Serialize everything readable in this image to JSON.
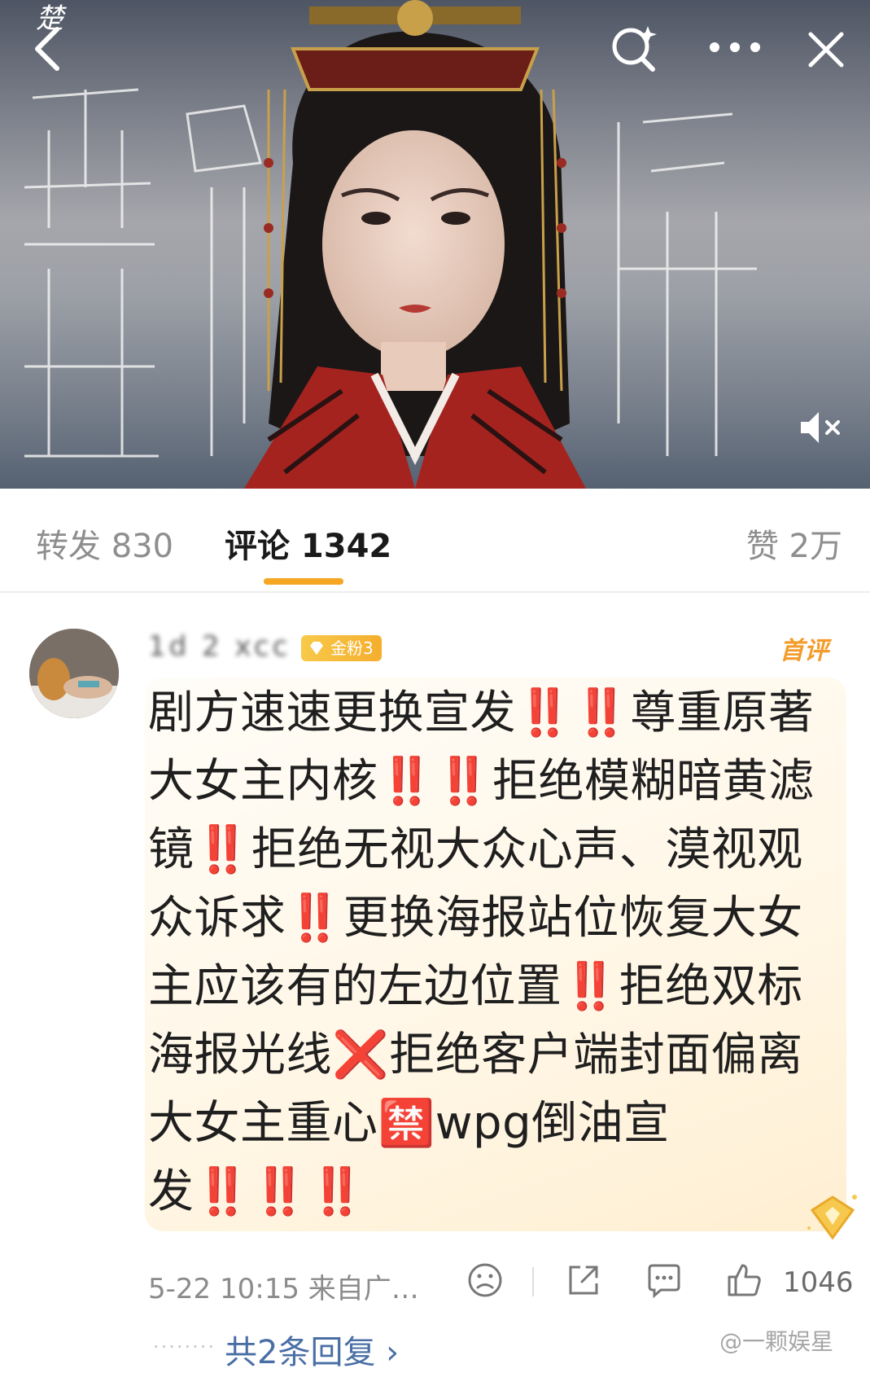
{
  "hero": {
    "title_calligraphy": "楚",
    "overlay_characters": [
      "垂",
      "帘",
      "听"
    ],
    "colors": {
      "sky_top": "#5f6775",
      "sky_mid": "#a5a6ac",
      "robe_red": "#a5231f"
    }
  },
  "tabs": {
    "repost": "转发 830",
    "comment": "评论 1342",
    "like": "赞 2万"
  },
  "comment": {
    "username": "1d  2  xcc",
    "fan_badge": "金粉3",
    "tag": "首评",
    "text": "剧方速速更换宣发‼️‼️尊重原著大女主内核‼️‼️拒绝模糊暗黄滤镜‼️拒绝无视大众心声、漠视观众诉求‼️更换海报站位恢复大女主应该有的左边位置‼️拒绝双标海报光线❌拒绝客户端封面偏离大女主重心🈲wpg倒油宣发‼️‼️‼️",
    "meta": "5-22 10:15  来自广…",
    "like_count": "1046",
    "replies": "共2条回复 ›",
    "icons": [
      "dislike-icon",
      "share-icon",
      "reply-icon",
      "like-icon"
    ]
  },
  "watermark": "@一颗娱星",
  "accent_color": "#f5a623"
}
